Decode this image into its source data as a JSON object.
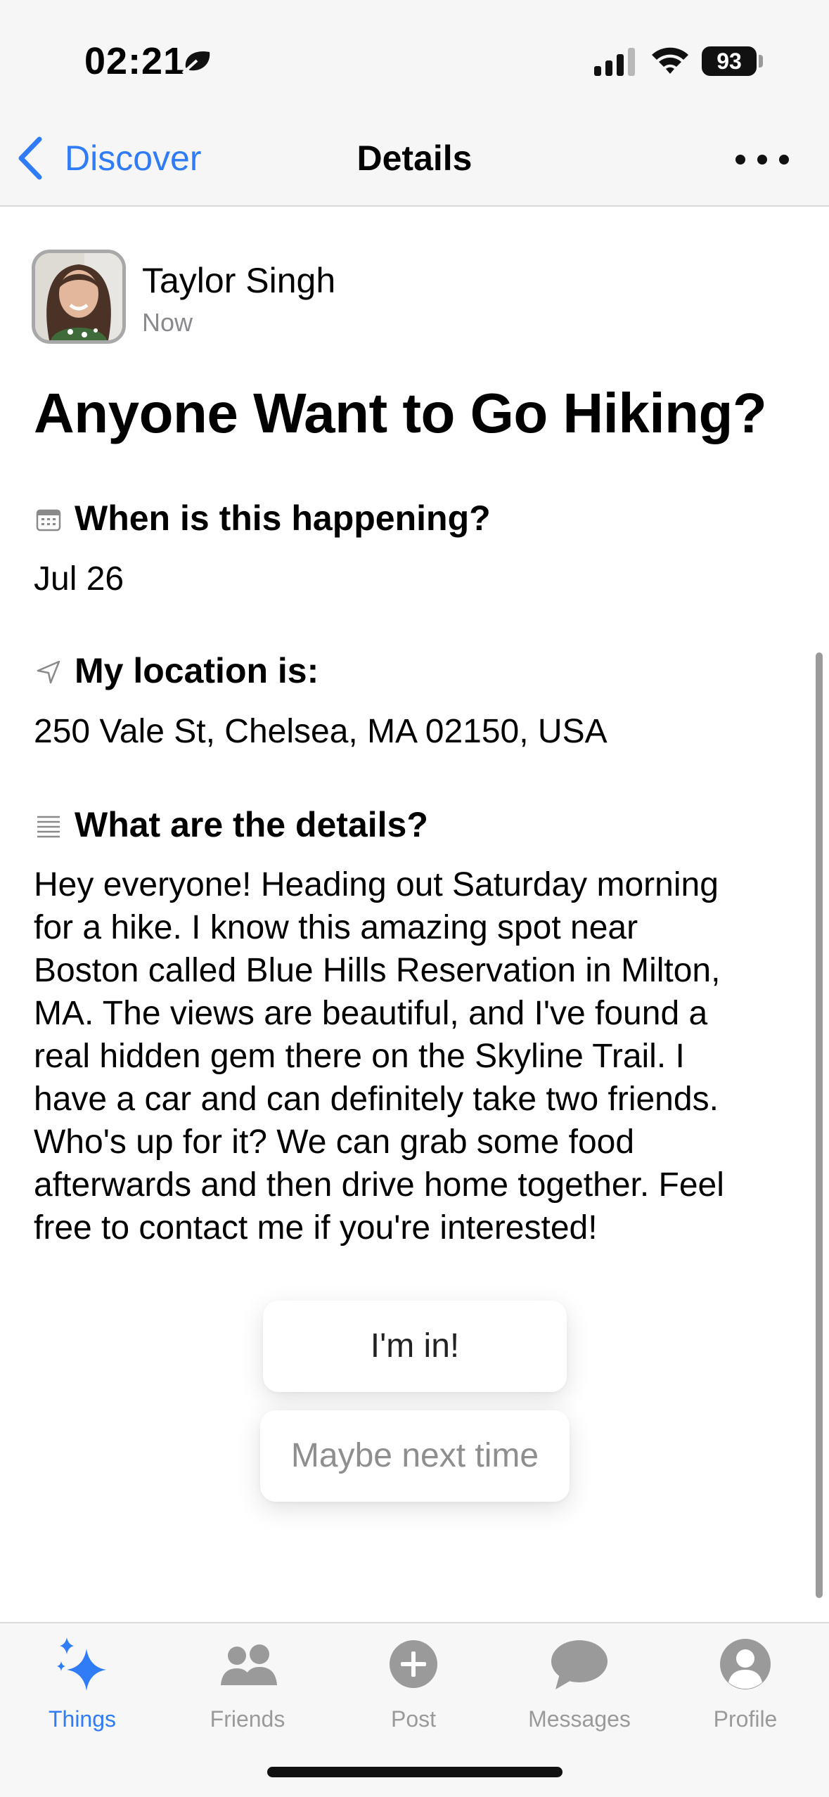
{
  "status_bar": {
    "time": "02:21",
    "battery": "93",
    "icons": [
      "focus-moon-icon",
      "cellular-signal-icon",
      "wifi-icon",
      "battery-icon"
    ]
  },
  "nav": {
    "back_label": "Discover",
    "title": "Details",
    "more_icon": "ellipsis-icon"
  },
  "post": {
    "author": "Taylor Singh",
    "time": "Now",
    "title": "Anyone Want to Go Hiking?",
    "sections": {
      "when": {
        "icon": "calendar-icon",
        "label": "When is this happening?",
        "value": "Jul 26"
      },
      "location": {
        "icon": "location-arrow-icon",
        "label": "My location is:",
        "value": "250 Vale St, Chelsea, MA 02150, USA"
      },
      "details": {
        "icon": "text-lines-icon",
        "label": "What are the details?",
        "lines": [
          "Hey everyone! Heading out Saturday morning",
          "for a hike. I know this amazing spot near",
          "Boston called Blue Hills Reservation in Milton,",
          "MA. The views are beautiful, and I've found a",
          "real hidden gem there on the Skyline Trail. I",
          "have a car and can definitely take two friends.",
          "Who's up for it? We can grab some food",
          "afterwards and then drive home together. Feel",
          "free to contact me if you're interested!"
        ]
      }
    }
  },
  "actions": {
    "join_label": "I'm in!",
    "decline_label": "Maybe next time"
  },
  "tab_bar": {
    "accent_color": "#2f7cf6",
    "inactive_color": "#9a9a9a",
    "tabs": [
      {
        "label": "Things",
        "icon": "sparkles-icon",
        "active": true
      },
      {
        "label": "Friends",
        "icon": "people-icon",
        "active": false
      },
      {
        "label": "Post",
        "icon": "plus-circle-icon",
        "active": false
      },
      {
        "label": "Messages",
        "icon": "chat-bubble-icon",
        "active": false
      },
      {
        "label": "Profile",
        "icon": "person-circle-icon",
        "active": false
      }
    ]
  }
}
